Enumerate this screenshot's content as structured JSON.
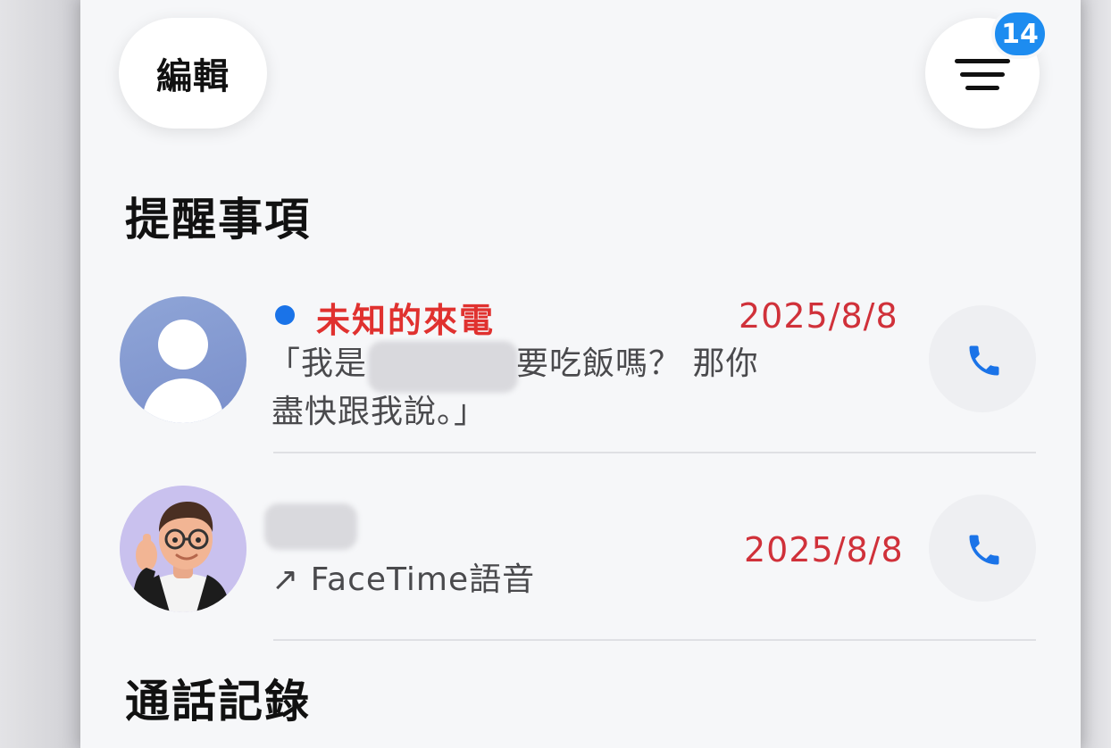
{
  "toolbar": {
    "edit_label": "編輯",
    "filter_icon": "filter-lines-icon",
    "badge_count": "14"
  },
  "sections": {
    "reminders_title": "提醒事項",
    "recents_title": "通話記錄"
  },
  "reminders": [
    {
      "name": "未知的來電",
      "date": "2025/8/8",
      "voicemail_prefix": "「我是",
      "voicemail_rest_line1": "要吃飯嗎？ 那你",
      "voicemail_line2": "盡快跟我說。」",
      "avatar": "person-silhouette-icon",
      "action_icon": "phone-icon"
    },
    {
      "name": "",
      "date": "2025/8/8",
      "subtitle": "↗ FaceTime語音",
      "avatar": "memoji-avatar",
      "action_icon": "phone-icon"
    }
  ],
  "colors": {
    "accent_blue": "#1a73e8",
    "missed_red": "#e0312f",
    "badge_blue": "#1d8cf0"
  }
}
